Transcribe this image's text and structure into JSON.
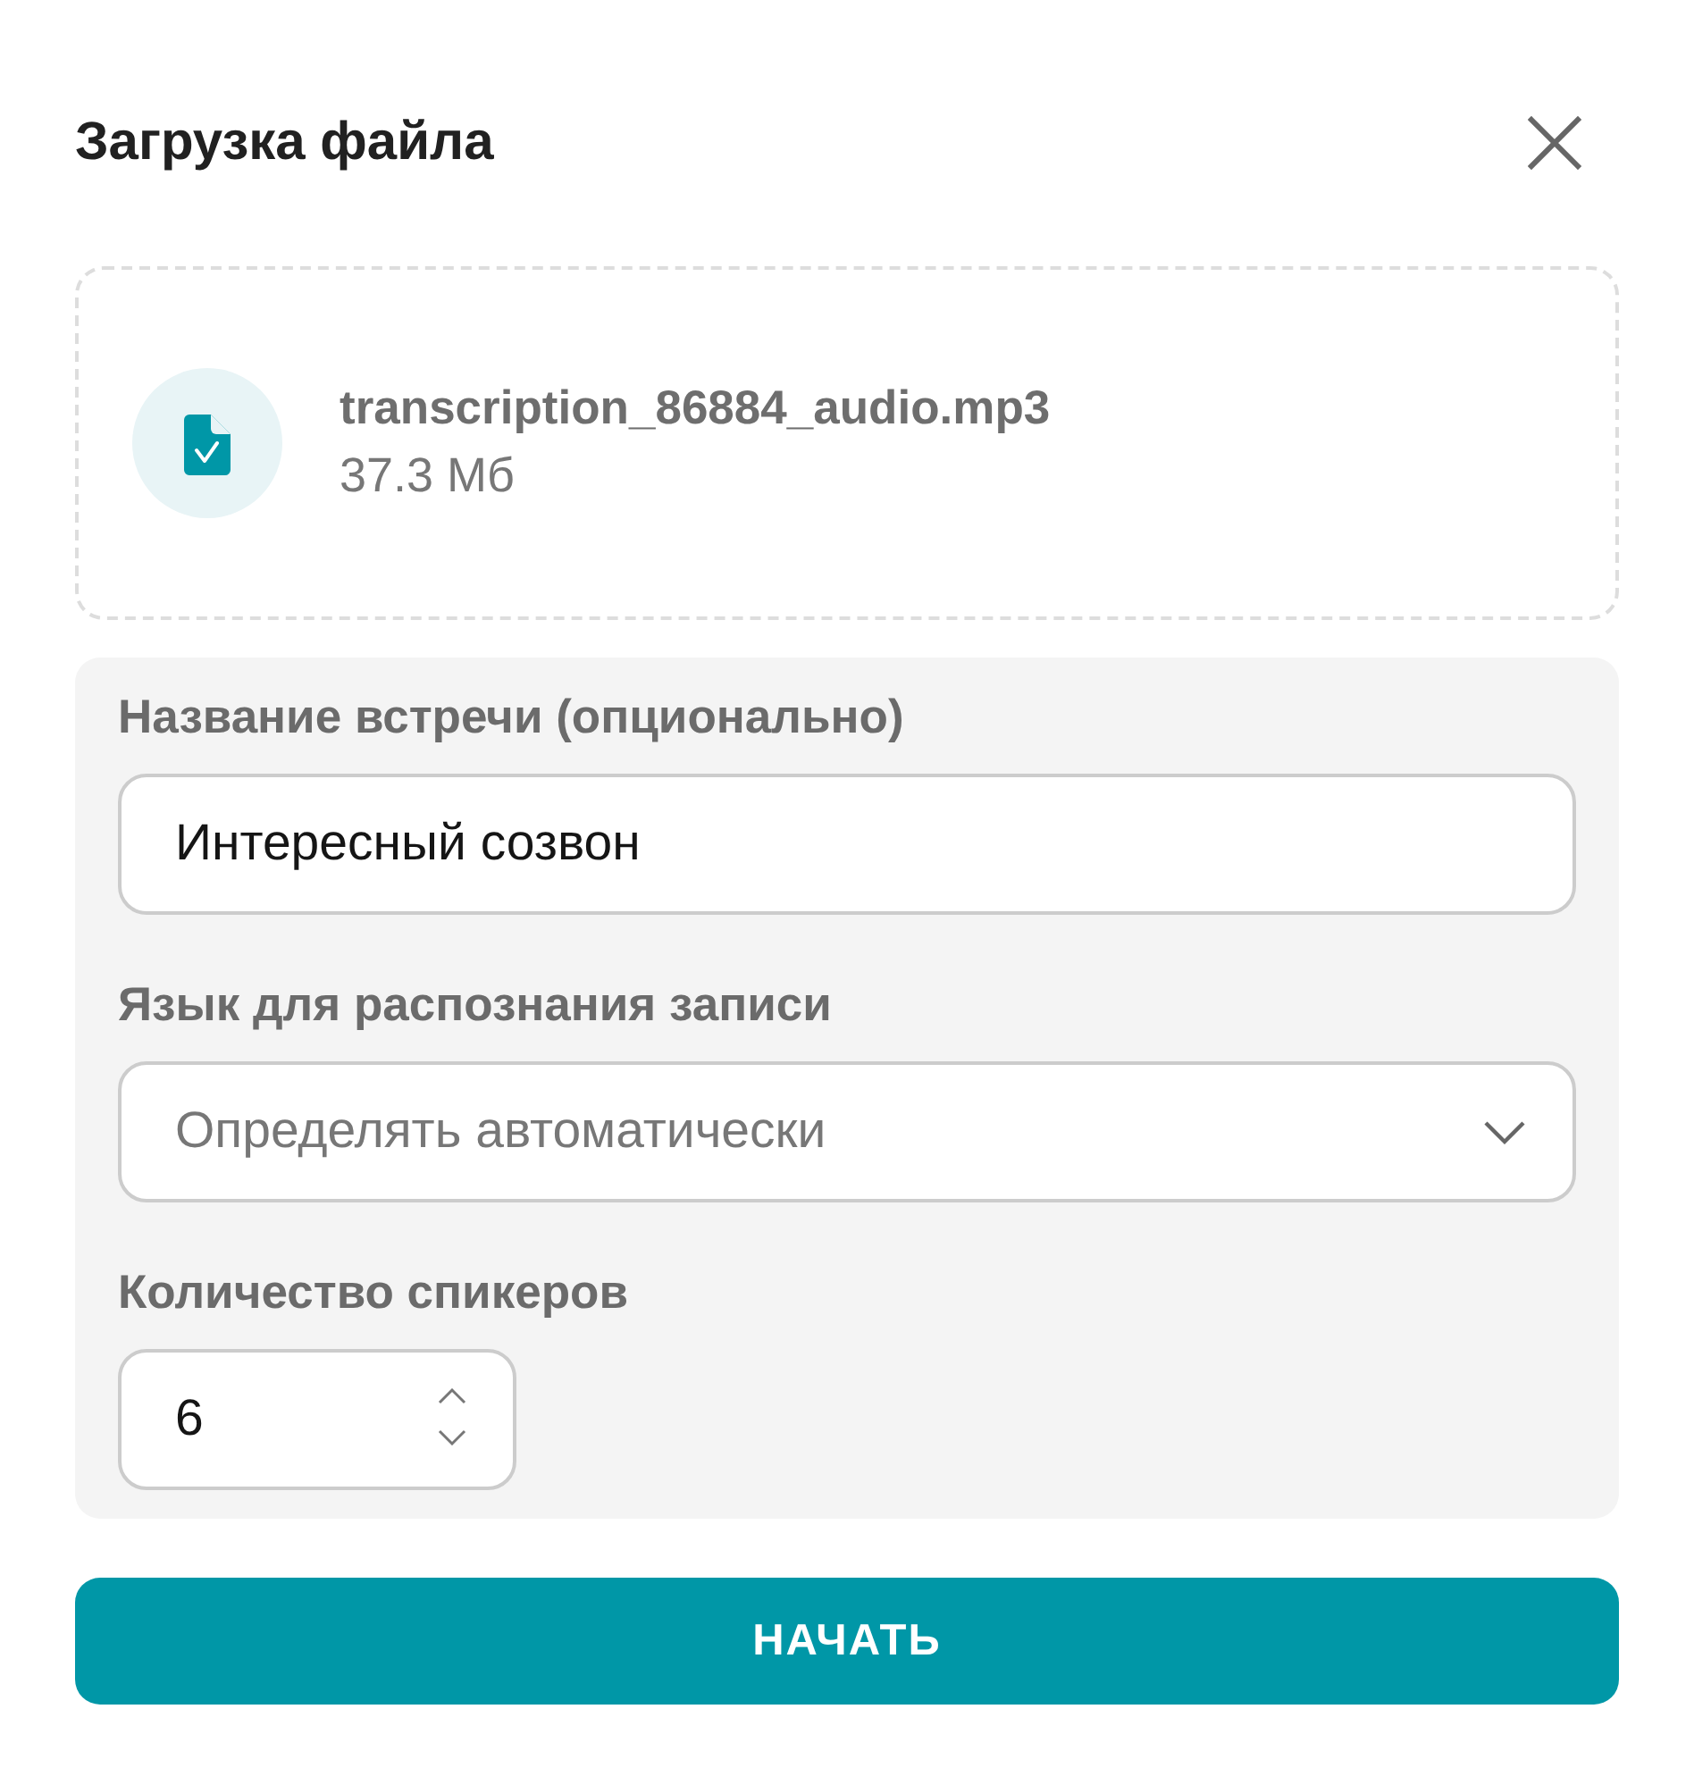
{
  "dialog": {
    "title": "Загрузка файла"
  },
  "file": {
    "name": "transcription_86884_audio.mp3",
    "size": "37.3 Мб"
  },
  "fields": [
    {
      "kind": "text",
      "label": "Название встречи (опционально)",
      "value": "Интересный созвон"
    },
    {
      "kind": "select",
      "label": "Язык для распознания записи",
      "placeholder": "Определять автоматически"
    },
    {
      "kind": "number",
      "label": "Количество спикеров",
      "value": "6"
    }
  ],
  "primary_button": {
    "label": "НАЧАТЬ"
  }
}
